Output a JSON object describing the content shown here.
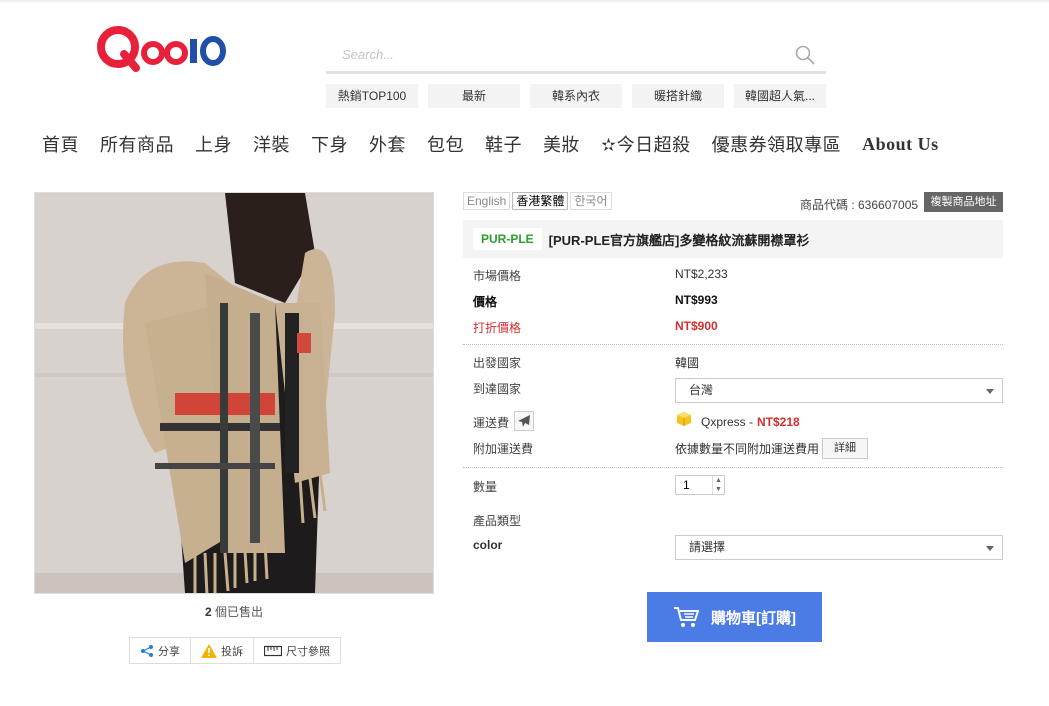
{
  "header": {
    "logo_text": "Qoo10",
    "search_placeholder": "Search...",
    "keywords": [
      "熱銷TOP100",
      "最新",
      "韓系內衣",
      "暖搭針織",
      "韓國超人氣..."
    ]
  },
  "nav": [
    "首頁",
    "所有商品",
    "上身",
    "洋裝",
    "下身",
    "外套",
    "包包",
    "鞋子",
    "美妝",
    "✫今日超殺",
    "優惠券領取專區",
    "About Us"
  ],
  "gallery": {
    "sold_count": "2",
    "sold_suffix": " 個已售出",
    "tools": [
      "分享",
      "投訴",
      "尺寸參照"
    ]
  },
  "product": {
    "languages": [
      "English",
      "香港繁體",
      "한국어"
    ],
    "code_label": "商品代碼 : 636607005",
    "copy_button": "複製商品地址",
    "brand": "PUR-PLE",
    "title": "[PUR-PLE官方旗艦店]多變格紋流蘇開襟罩衫",
    "market_price_label": "市場價格",
    "market_price": "NT$2,233",
    "price_label": "價格",
    "price": "NT$993",
    "discount_label": "打折價格",
    "discount_price": "NT$900",
    "origin_label": "出發國家",
    "origin": "韓國",
    "dest_label": "到達國家",
    "dest": "台灣",
    "shipping_label": "運送費",
    "shipping_carrier": "Qxpress -",
    "shipping_price": "NT$218",
    "extra_shipping_label": "附加運送費",
    "extra_shipping_text": "依據數量不同附加運送費用",
    "detail_button": "詳細",
    "qty_label": "數量",
    "qty_value": "1",
    "type_label": "產品類型",
    "color_label": "color",
    "color_placeholder": "請選擇",
    "cart_button": "購物車[訂購]"
  },
  "colors": {
    "cart_blue": "#4b7be5",
    "discount_red": "#d32f2f",
    "brand_green": "#2e9d2e",
    "logo_red": "#e8203a",
    "logo_blue": "#1f4fa8"
  }
}
